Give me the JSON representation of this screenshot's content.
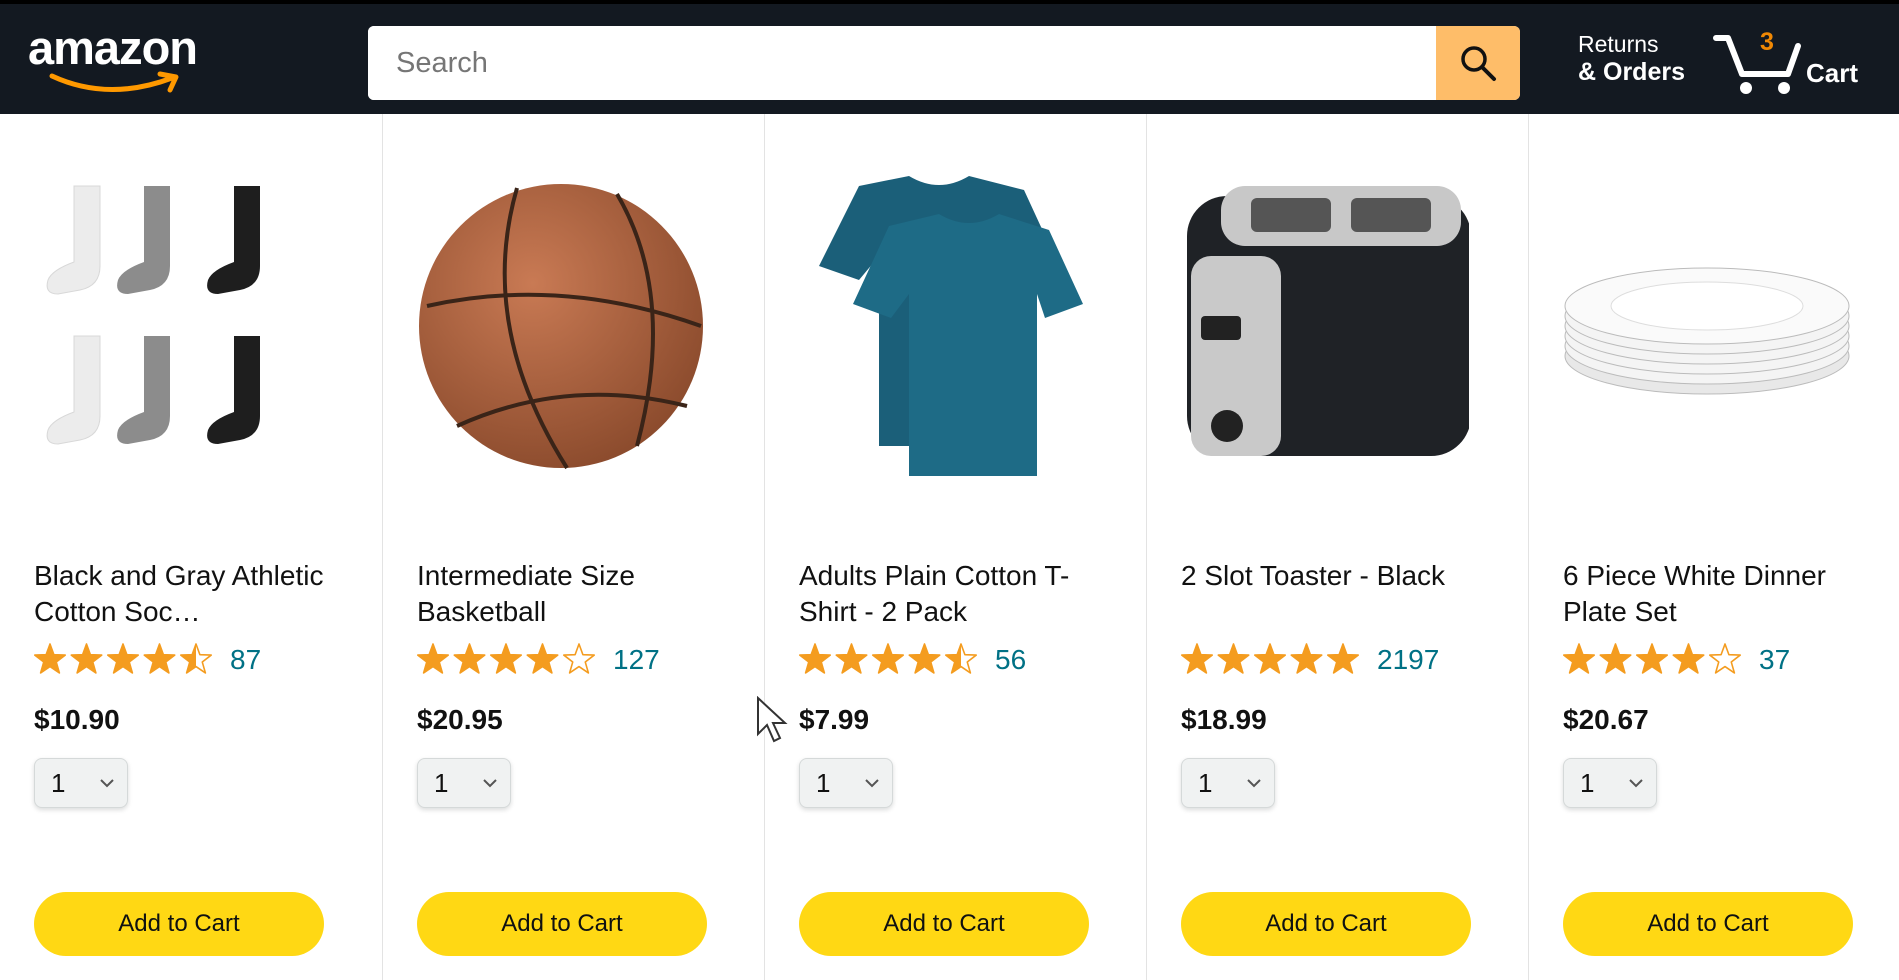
{
  "header": {
    "logo_text": "amazon",
    "search": {
      "placeholder": "Search",
      "value": "",
      "icon": "search-icon"
    },
    "returns": {
      "line1": "Returns",
      "line2": "& Orders"
    },
    "cart": {
      "count": "3",
      "label": "Cart",
      "icon": "cart-icon"
    }
  },
  "colors": {
    "header_bg": "#131921",
    "search_button": "#febd69",
    "cart_count": "#f08804",
    "add_to_cart": "#ffd814",
    "star": "#f49c1f",
    "rating_link": "#007185"
  },
  "products": [
    {
      "name": "Black and Gray Athletic Cotton Soc…",
      "image": "socks-image",
      "rating": 4.5,
      "rating_count": "87",
      "price": "$10.90",
      "quantity": "1",
      "button": "Add to Cart"
    },
    {
      "name": "Intermediate Size Basketball",
      "image": "basketball-image",
      "rating": 4,
      "rating_count": "127",
      "price": "$20.95",
      "quantity": "1",
      "button": "Add to Cart"
    },
    {
      "name": "Adults Plain Cotton T-Shirt - 2 Pack",
      "image": "tshirt-image",
      "rating": 4.5,
      "rating_count": "56",
      "price": "$7.99",
      "quantity": "1",
      "button": "Add to Cart"
    },
    {
      "name": "2 Slot Toaster - Black",
      "image": "toaster-image",
      "rating": 5,
      "rating_count": "2197",
      "price": "$18.99",
      "quantity": "1",
      "button": "Add to Cart"
    },
    {
      "name": "6 Piece White Dinner Plate Set",
      "image": "plates-image",
      "rating": 4,
      "rating_count": "37",
      "price": "$20.67",
      "quantity": "1",
      "button": "Add to Cart"
    }
  ]
}
